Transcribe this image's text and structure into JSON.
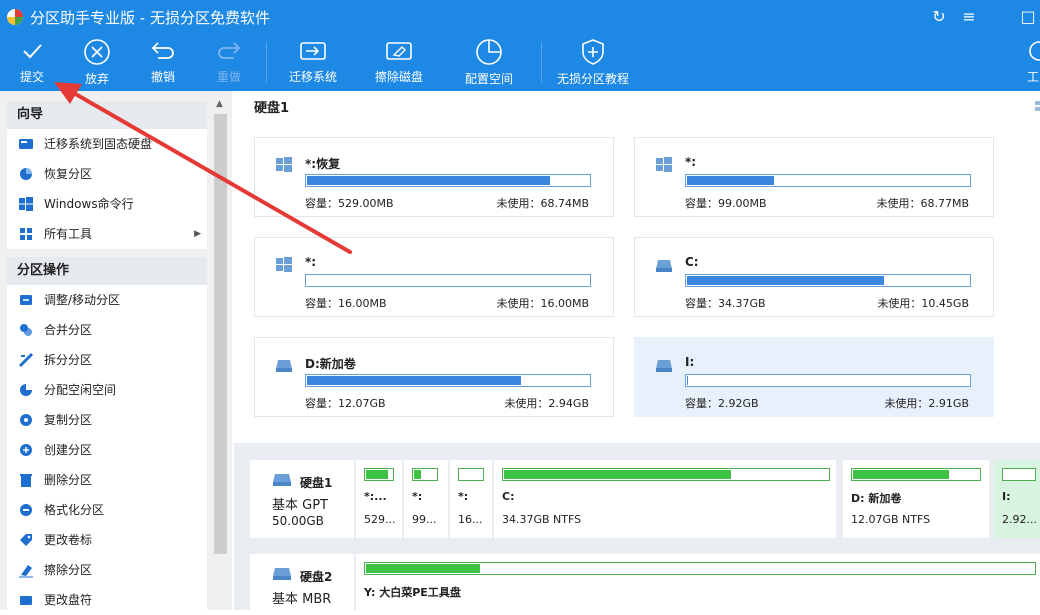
{
  "window": {
    "title": "分区助手专业版 - 无损分区免费软件",
    "controls": [
      "↻",
      "≡",
      "□"
    ]
  },
  "toolbar": {
    "items": [
      {
        "label": "提交",
        "icon": "check-icon"
      },
      {
        "label": "放弃",
        "icon": "cancel-circle-icon"
      },
      {
        "label": "撤销",
        "icon": "undo-icon"
      },
      {
        "label": "重做",
        "icon": "redo-icon"
      },
      {
        "label": "迁移系统",
        "icon": "migrate-disk-icon"
      },
      {
        "label": "擦除磁盘",
        "icon": "wipe-disk-icon"
      },
      {
        "label": "配置空间",
        "icon": "pie-chart-icon"
      },
      {
        "label": "无损分区教程",
        "icon": "shield-plus-icon"
      },
      {
        "label": "工"
      }
    ]
  },
  "sidebar": {
    "wizard": {
      "title": "向导",
      "items": [
        {
          "label": "迁移系统到固态硬盘",
          "icon": "ssd-icon"
        },
        {
          "label": "恢复分区",
          "icon": "recover-icon"
        },
        {
          "label": "Windows命令行",
          "icon": "windows-icon"
        },
        {
          "label": "所有工具",
          "icon": "grid-icon"
        }
      ]
    },
    "ops": {
      "title": "分区操作",
      "items": [
        {
          "label": "调整/移动分区",
          "icon": "resize-icon"
        },
        {
          "label": "合并分区",
          "icon": "merge-icon"
        },
        {
          "label": "拆分分区",
          "icon": "split-icon"
        },
        {
          "label": "分配空闲空间",
          "icon": "allocate-icon"
        },
        {
          "label": "复制分区",
          "icon": "copy-icon"
        },
        {
          "label": "创建分区",
          "icon": "create-icon"
        },
        {
          "label": "删除分区",
          "icon": "delete-icon"
        },
        {
          "label": "格式化分区",
          "icon": "format-icon"
        },
        {
          "label": "更改卷标",
          "icon": "label-icon"
        },
        {
          "label": "擦除分区",
          "icon": "eraser-icon"
        },
        {
          "label": "更改盘符",
          "icon": "drive-letter-icon"
        }
      ]
    }
  },
  "main": {
    "disk_title": "硬盘1",
    "partitions": [
      {
        "name": "*:恢复",
        "icon": "windows-icon",
        "used_pct": 86,
        "cap": "容量：529.00MB",
        "free": "未使用：68.74MB"
      },
      {
        "name": "*:",
        "icon": "windows-icon",
        "used_pct": 31,
        "cap": "容量：99.00MB",
        "free": "未使用：68.77MB"
      },
      {
        "name": "*:",
        "icon": "windows-icon",
        "used_pct": 0,
        "cap": "容量：16.00MB",
        "free": "未使用：16.00MB"
      },
      {
        "name": "C:",
        "icon": "drive-icon",
        "used_pct": 70,
        "cap": "容量：34.37GB",
        "free": "未使用：10.45GB"
      },
      {
        "name": "D:新加卷",
        "icon": "drive-icon",
        "used_pct": 76,
        "cap": "容量：12.07GB",
        "free": "未使用：2.94GB"
      },
      {
        "name": "I:",
        "icon": "drive-icon",
        "used_pct": 0.3,
        "cap": "容量：2.92GB",
        "free": "未使用：2.91GB"
      }
    ]
  },
  "lower": {
    "disk1": {
      "name": "硬盘1",
      "type": "基本 GPT",
      "size": "50.00GB",
      "parts": [
        {
          "name": "*:...",
          "info": "529...",
          "used_pct": 86
        },
        {
          "name": "*:",
          "info": "99...",
          "used_pct": 31
        },
        {
          "name": "*:",
          "info": "16...",
          "used_pct": 0
        },
        {
          "name": "C:",
          "info": "34.37GB NTFS",
          "used_pct": 70
        },
        {
          "name": "D: 新加卷",
          "info": "12.07GB NTFS",
          "used_pct": 76
        },
        {
          "name": "I:",
          "info": "2.92...",
          "used_pct": 0
        }
      ]
    },
    "disk2": {
      "name": "硬盘2",
      "type": "基本 MBR",
      "parts": [
        {
          "name": "Y: 大白菜PE工具盘",
          "used_pct": 17
        }
      ]
    }
  },
  "colors": {
    "accent": "#1e88e5",
    "bar_blue": "#3a86e0",
    "bar_green": "#3ec244",
    "annotation": "#e53935"
  }
}
